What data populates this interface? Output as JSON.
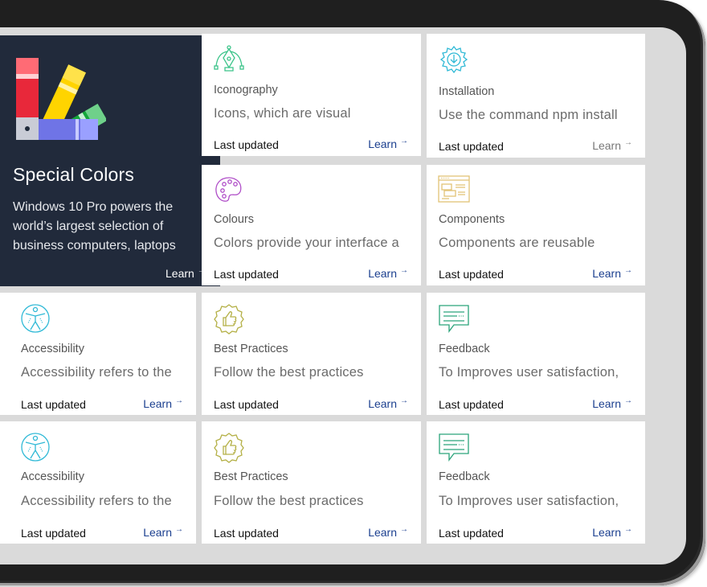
{
  "featured": {
    "title": "Special Colors",
    "description": "Windows 10 Pro powers the world’s largest selection of business computers, laptops",
    "learn": "Learn",
    "arrow": "→"
  },
  "cards": [
    {
      "title": "Iconography",
      "desc": "Icons, which are visual",
      "updated": "Last updated",
      "learn": "Learn",
      "arrow": "→",
      "icon": "pen-tool-icon"
    },
    {
      "title": "Installation",
      "desc": "Use the command npm install",
      "updated": "Last updated",
      "learn": "Learn",
      "arrow": "→",
      "icon": "download-gear-icon"
    },
    {
      "title": "Colours",
      "desc": "Colors provide your interface a",
      "updated": "Last updated",
      "learn": "Learn",
      "arrow": "→",
      "icon": "palette-icon"
    },
    {
      "title": "Components",
      "desc": "Components are reusable",
      "updated": "Last updated",
      "learn": "Learn",
      "arrow": "→",
      "icon": "layout-icon"
    },
    {
      "title": "Accessibility",
      "desc": "Accessibility refers to the",
      "updated": "Last updated",
      "learn": "Learn",
      "arrow": "→",
      "icon": "accessibility-icon"
    },
    {
      "title": "Best Practices",
      "desc": "Follow the best practices",
      "updated": "Last updated",
      "learn": "Learn",
      "arrow": "→",
      "icon": "thumbs-up-badge-icon"
    },
    {
      "title": "Feedback",
      "desc": "To Improves user satisfaction,",
      "updated": "Last updated",
      "learn": "Learn",
      "arrow": "→",
      "icon": "chat-bubble-icon"
    },
    {
      "title": "Accessibility",
      "desc": "Accessibility refers to the",
      "updated": "Last updated",
      "learn": "Learn",
      "arrow": "→",
      "icon": "accessibility-icon"
    },
    {
      "title": "Best Practices",
      "desc": "Follow the best practices",
      "updated": "Last updated",
      "learn": "Learn",
      "arrow": "→",
      "icon": "thumbs-up-badge-icon"
    },
    {
      "title": "Feedback",
      "desc": "To Improves user satisfaction,",
      "updated": "Last updated",
      "learn": "Learn",
      "arrow": "→",
      "icon": "chat-bubble-icon"
    }
  ],
  "colors": {
    "featured_bg": "#212a3b",
    "link": "#1b3f8f",
    "icon_green": "#3cc48a",
    "icon_purple": "#b04fc8",
    "icon_cyan": "#2fb9d6",
    "icon_olive": "#b4b046",
    "icon_gold": "#e2c275",
    "icon_teal": "#2aa37a"
  }
}
